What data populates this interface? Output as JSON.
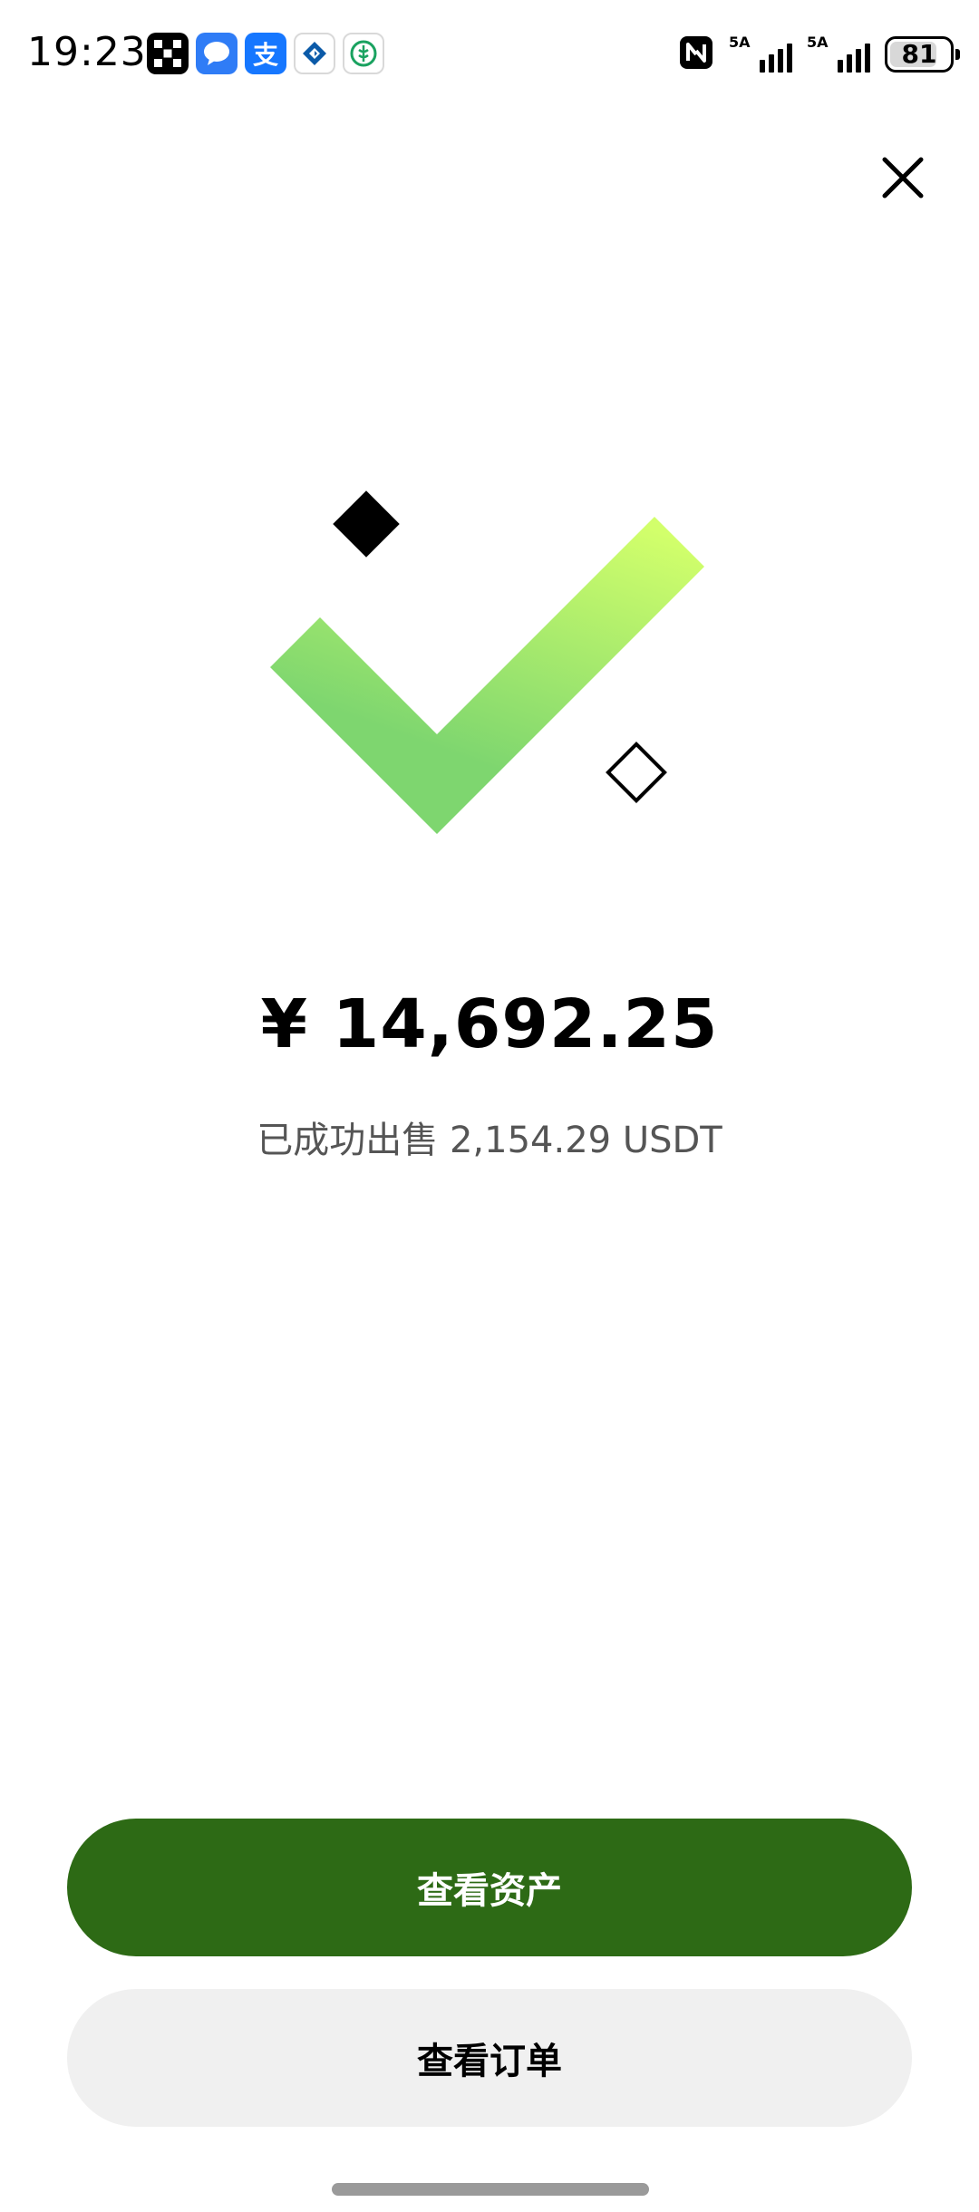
{
  "status_bar": {
    "time": "19:23",
    "notification_icons": [
      "okx-icon",
      "message-icon",
      "alipay-icon",
      "bank-icon",
      "agri-bank-icon"
    ],
    "alipay_glyph": "支",
    "nfc_icon": "nfc-icon",
    "signal_1": {
      "tag": "5A",
      "level": 4
    },
    "signal_2": {
      "tag": "5A",
      "level": 4
    },
    "battery": {
      "level": "81",
      "fraction": 0.81
    }
  },
  "header": {
    "close_icon": "close-icon"
  },
  "illustration": {
    "icon": "success-checkmark-icon",
    "gradient": [
      "#d2ff6b",
      "#7ed66f"
    ]
  },
  "result": {
    "amount": "¥ 14,692.25",
    "sold_text": "已成功出售 2,154.29 USDT"
  },
  "actions": {
    "view_assets_label": "查看资产",
    "view_orders_label": "查看订单"
  },
  "colors": {
    "primary_button": "#2d6a15",
    "secondary_button": "#f0f0f0",
    "sub_text": "#555555"
  }
}
